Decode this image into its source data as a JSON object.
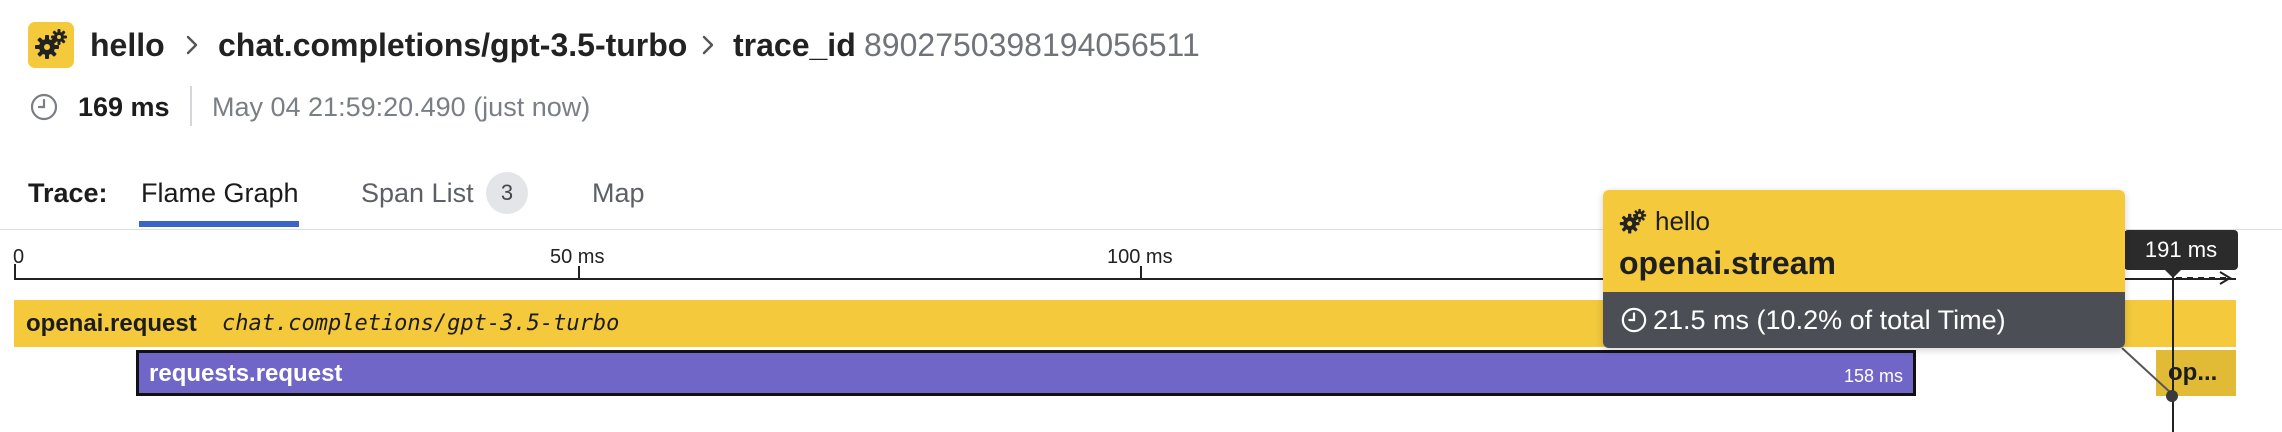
{
  "header": {
    "service": "hello",
    "resource": "chat.completions/gpt-3.5-turbo",
    "trace_id_label": "trace_id",
    "trace_id": "8902750398194056511",
    "duration": "169 ms",
    "timestamp": "May 04 21:59:20.490 (just now)"
  },
  "tabs": {
    "prefix": "Trace:",
    "items": [
      {
        "label": "Flame Graph",
        "active": true
      },
      {
        "label": "Span List",
        "badge": "3"
      },
      {
        "label": "Map"
      }
    ]
  },
  "timeline": {
    "ticks": [
      "0",
      "50 ms",
      "100 ms"
    ],
    "cursor_label": "191 ms"
  },
  "spans": {
    "openai_request": {
      "name": "openai.request",
      "resource": "chat.completions/gpt-3.5-turbo"
    },
    "requests_request": {
      "name": "requests.request",
      "duration": "158 ms"
    },
    "openai_stream_truncated": {
      "name": "op..."
    }
  },
  "tooltip": {
    "service": "hello",
    "operation": "openai.stream",
    "duration": "21.5 ms (10.2% of total Time)"
  },
  "colors": {
    "service_yellow": "#f4c93c",
    "requests_purple": "#7066c8",
    "tab_accent": "#3a65c7",
    "tooltip_dark": "#4b4e55"
  },
  "icons": {
    "service": "gears-icon",
    "breadcrumb_separator": "chevron-right-icon",
    "duration": "clock-icon"
  }
}
